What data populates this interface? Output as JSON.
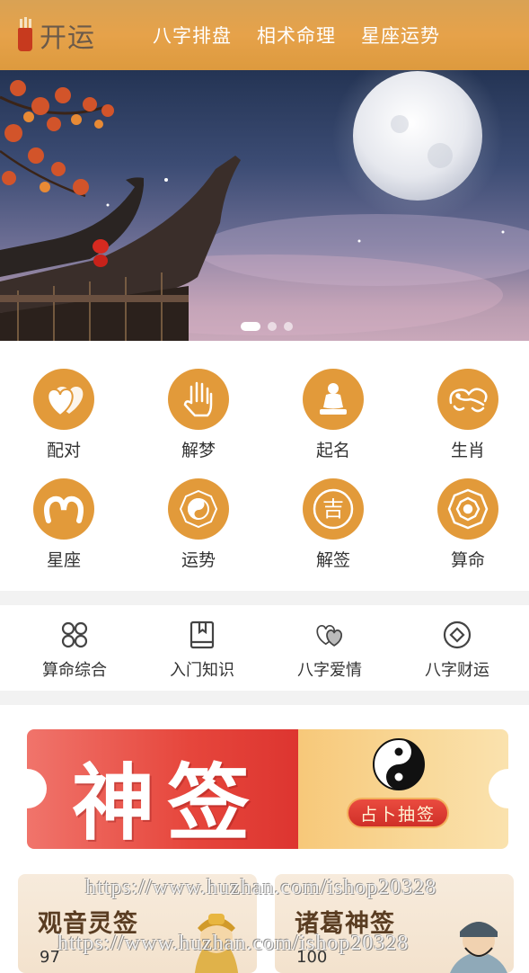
{
  "header": {
    "logo_text": "开运",
    "nav": [
      "八字排盘",
      "相术命理",
      "星座运势"
    ]
  },
  "banner": {
    "slide_count": 3,
    "active_slide": 1
  },
  "grid": {
    "items": [
      {
        "label": "配对",
        "icon": "hearts-icon"
      },
      {
        "label": "解梦",
        "icon": "hand-icon"
      },
      {
        "label": "起名",
        "icon": "buddha-icon"
      },
      {
        "label": "生肖",
        "icon": "zodiac-animal-icon"
      },
      {
        "label": "星座",
        "icon": "aries-icon"
      },
      {
        "label": "运势",
        "icon": "bagua-yinyang-icon"
      },
      {
        "label": "解签",
        "icon": "ji-character-icon"
      },
      {
        "label": "算命",
        "icon": "bagua-icon"
      }
    ],
    "ji_char": "吉"
  },
  "quick": {
    "items": [
      {
        "label": "算命综合",
        "icon": "four-circles-icon"
      },
      {
        "label": "入门知识",
        "icon": "book-icon"
      },
      {
        "label": "八字爱情",
        "icon": "double-heart-icon"
      },
      {
        "label": "八字财运",
        "icon": "diamond-circle-icon"
      }
    ]
  },
  "ticket": {
    "title": "神签",
    "button": "占卜抽签"
  },
  "cards": [
    {
      "title": "观音灵签",
      "count": "97"
    },
    {
      "title": "诸葛神签",
      "count": "100"
    }
  ],
  "watermark": "https://www.huzhan.com/ishop20328",
  "colors": {
    "accent": "#e29a3a",
    "header": "#e6a24a",
    "ticket_red": "#e6463c",
    "ticket_gold": "#f9d99a"
  }
}
